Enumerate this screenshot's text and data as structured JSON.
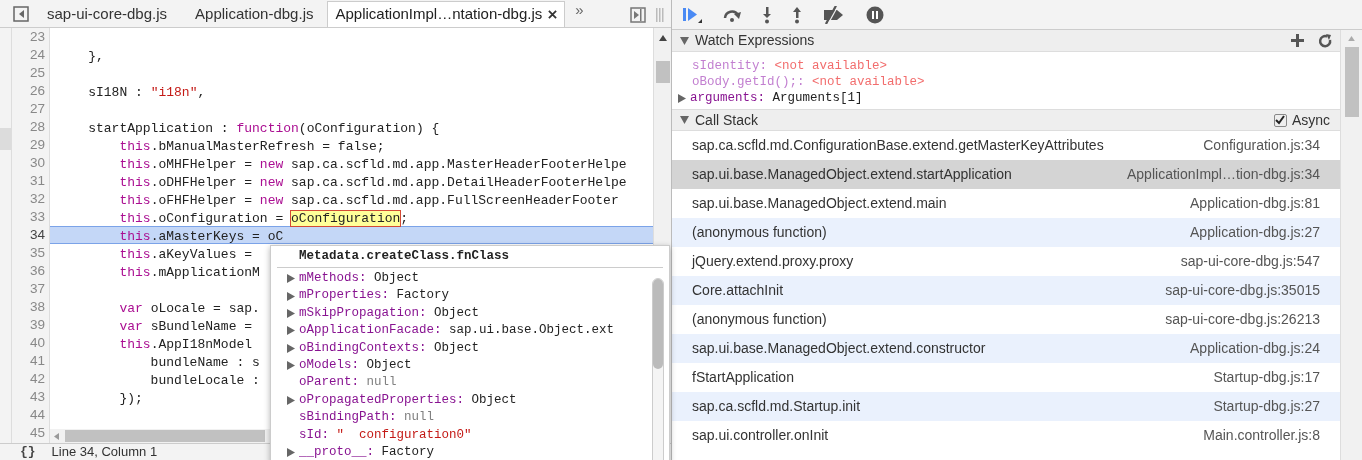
{
  "tabs": [
    {
      "label": "sap-ui-core-dbg.js",
      "selected": false,
      "closable": false
    },
    {
      "label": "Application-dbg.js",
      "selected": false,
      "closable": false
    },
    {
      "label": "ApplicationImpl…ntation-dbg.js",
      "selected": true,
      "closable": true
    }
  ],
  "tab_overflow": "»",
  "code_lines": [
    {
      "number": "23",
      "selected": false
    },
    {
      "number": "24",
      "selected": false,
      "tokens": [
        {
          "kind": "plain",
          "text": "    },"
        }
      ]
    },
    {
      "number": "25",
      "selected": false
    },
    {
      "number": "26",
      "selected": false,
      "tokens": [
        {
          "kind": "plain",
          "text": "    sI18N : "
        },
        {
          "kind": "string",
          "text": "\"i18n\""
        },
        {
          "kind": "plain",
          "text": ","
        }
      ]
    },
    {
      "number": "27",
      "selected": false
    },
    {
      "number": "28",
      "selected": false,
      "tokens": [
        {
          "kind": "plain",
          "text": "    startApplication : "
        },
        {
          "kind": "keyword",
          "text": "function"
        },
        {
          "kind": "plain",
          "text": "(oConfiguration) {"
        }
      ]
    },
    {
      "number": "29",
      "selected": false,
      "tokens": [
        {
          "kind": "keyword",
          "text": "        this"
        },
        {
          "kind": "plain",
          "text": ".bManualMasterRefresh = false;"
        }
      ]
    },
    {
      "number": "30",
      "selected": false,
      "tokens": [
        {
          "kind": "keyword",
          "text": "        this"
        },
        {
          "kind": "plain",
          "text": ".oMHFHelper = "
        },
        {
          "kind": "keyword",
          "text": "new"
        },
        {
          "kind": "plain",
          "text": " sap.ca.scfld.md.app.MasterHeaderFooterHelpe"
        }
      ]
    },
    {
      "number": "31",
      "selected": false,
      "tokens": [
        {
          "kind": "keyword",
          "text": "        this"
        },
        {
          "kind": "plain",
          "text": ".oDHFHelper = "
        },
        {
          "kind": "keyword",
          "text": "new"
        },
        {
          "kind": "plain",
          "text": " sap.ca.scfld.md.app.DetailHeaderFooterHelpe"
        }
      ]
    },
    {
      "number": "32",
      "selected": false,
      "tokens": [
        {
          "kind": "keyword",
          "text": "        this"
        },
        {
          "kind": "plain",
          "text": ".oFHFHelper = "
        },
        {
          "kind": "keyword",
          "text": "new"
        },
        {
          "kind": "plain",
          "text": " sap.ca.scfld.md.app.FullScreenHeaderFooter"
        }
      ]
    },
    {
      "number": "33",
      "selected": false,
      "tokens": [
        {
          "kind": "keyword",
          "text": "        this"
        },
        {
          "kind": "plain",
          "text": ".oConfiguration = "
        },
        {
          "kind": "highlight",
          "text": "oConfiguration"
        },
        {
          "kind": "plain",
          "text": ";"
        }
      ]
    },
    {
      "number": "34",
      "selected": true,
      "tokens": [
        {
          "kind": "keyword",
          "text": "        this"
        },
        {
          "kind": "plain",
          "text": ".aMasterKeys = oC"
        }
      ]
    },
    {
      "number": "35",
      "selected": false,
      "tokens": [
        {
          "kind": "keyword",
          "text": "        this"
        },
        {
          "kind": "plain",
          "text": ".aKeyValues = "
        }
      ]
    },
    {
      "number": "36",
      "selected": false,
      "tokens": [
        {
          "kind": "keyword",
          "text": "        this"
        },
        {
          "kind": "plain",
          "text": ".mApplicationM"
        }
      ]
    },
    {
      "number": "37",
      "selected": false
    },
    {
      "number": "38",
      "selected": false,
      "tokens": [
        {
          "kind": "keyword",
          "text": "        var"
        },
        {
          "kind": "plain",
          "text": " oLocale = sap."
        }
      ]
    },
    {
      "number": "39",
      "selected": false,
      "tokens": [
        {
          "kind": "keyword",
          "text": "        var"
        },
        {
          "kind": "plain",
          "text": " sBundleName = "
        }
      ]
    },
    {
      "number": "40",
      "selected": false,
      "tokens": [
        {
          "kind": "keyword",
          "text": "        this"
        },
        {
          "kind": "plain",
          "text": ".AppI18nModel "
        }
      ]
    },
    {
      "number": "41",
      "selected": false,
      "tokens": [
        {
          "kind": "plain",
          "text": "            bundleName : s"
        }
      ]
    },
    {
      "number": "42",
      "selected": false,
      "tokens": [
        {
          "kind": "plain",
          "text": "            bundleLocale : "
        }
      ]
    },
    {
      "number": "43",
      "selected": false,
      "tokens": [
        {
          "kind": "plain",
          "text": "        });"
        }
      ]
    },
    {
      "number": "44",
      "selected": false
    },
    {
      "number": "45",
      "selected": false
    }
  ],
  "popover": {
    "title": "Metadata.createClass.fnClass",
    "properties": [
      {
        "kind": "expandable",
        "key": "mMethods:",
        "value": "Object"
      },
      {
        "kind": "expandable",
        "key": "mProperties:",
        "value": "Factory"
      },
      {
        "kind": "expandable",
        "key": "mSkipPropagation:",
        "value": "Object"
      },
      {
        "kind": "expandable",
        "key": "oApplicationFacade:",
        "value": "sap.ui.base.Object.ext"
      },
      {
        "kind": "expandable",
        "key": "oBindingContexts:",
        "value": "Object"
      },
      {
        "kind": "expandable",
        "key": "oModels:",
        "value": "Object"
      },
      {
        "kind": "null",
        "key": "oParent:",
        "value": "null"
      },
      {
        "kind": "expandable",
        "key": "oPropagatedProperties:",
        "value": "Object"
      },
      {
        "kind": "null",
        "key": "sBindingPath:",
        "value": "null"
      },
      {
        "kind": "string",
        "key": "sId:",
        "value": "\"  configuration0\""
      },
      {
        "kind": "expandable",
        "key": "__proto__:",
        "value": "Factory"
      }
    ]
  },
  "status_bar": {
    "icon": "{}",
    "text": "Line 34, Column 1"
  },
  "watch_expressions": {
    "title": "Watch Expressions",
    "expanded": true,
    "items": [
      {
        "kind": "error",
        "key": "sIdentity:",
        "value": "<not available>"
      },
      {
        "kind": "error",
        "key": "oBody.getId();:",
        "value": "<not available>"
      },
      {
        "kind": "expandable",
        "key": "arguments:",
        "value": "Arguments[1]"
      }
    ]
  },
  "call_stack": {
    "title": "Call Stack",
    "expanded": true,
    "async": {
      "label": "Async",
      "checked": true
    },
    "frames": [
      {
        "function": "sap.ca.scfld.md.ConfigurationBase.extend.getMasterKeyAttributes",
        "location": "Configuration.js:34",
        "selected": false
      },
      {
        "function": "sap.ui.base.ManagedObject.extend.startApplication",
        "location": "ApplicationImpl…tion-dbg.js:34",
        "selected": true
      },
      {
        "function": "sap.ui.base.ManagedObject.extend.main",
        "location": "Application-dbg.js:81",
        "selected": false
      },
      {
        "function": "(anonymous function)",
        "location": "Application-dbg.js:27",
        "selected": false
      },
      {
        "function": "jQuery.extend.proxy.proxy",
        "location": "sap-ui-core-dbg.js:547",
        "selected": false
      },
      {
        "function": "Core.attachInit",
        "location": "sap-ui-core-dbg.js:35015",
        "selected": false
      },
      {
        "function": "(anonymous function)",
        "location": "sap-ui-core-dbg.js:26213",
        "selected": false
      },
      {
        "function": "sap.ui.base.ManagedObject.extend.constructor",
        "location": "Application-dbg.js:24",
        "selected": false
      },
      {
        "function": "fStartApplication",
        "location": "Startup-dbg.js:17",
        "selected": false
      },
      {
        "function": "sap.ca.scfld.md.Startup.init",
        "location": "Startup-dbg.js:27",
        "selected": false
      },
      {
        "function": "sap.ui.controller.onInit",
        "location": "Main.controller.js:8",
        "selected": false
      }
    ]
  }
}
